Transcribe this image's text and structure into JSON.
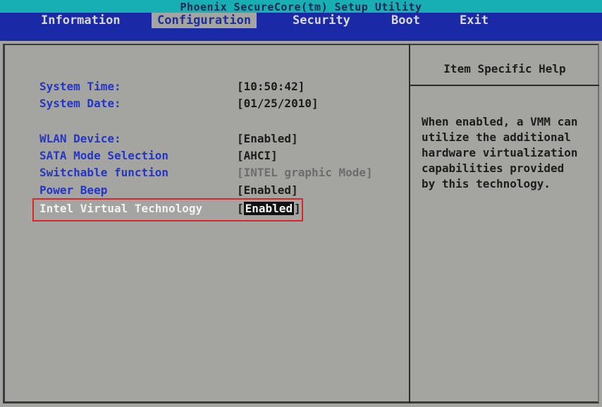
{
  "title": "Phoenix SecureCore(tm) Setup Utility",
  "menu": [
    "Information",
    "Configuration",
    "Security",
    "Boot",
    "Exit"
  ],
  "active_menu": "Configuration",
  "settings": [
    {
      "label": "System Time:",
      "value": "[10:50:42]"
    },
    {
      "label": "System Date:",
      "value": "[01/25/2010]"
    },
    {
      "label": "WLAN Device:",
      "value": "[Enabled]"
    },
    {
      "label": "SATA Mode Selection",
      "value": "[AHCI]"
    },
    {
      "label": "Switchable function",
      "value": "[INTEL graphic Mode]"
    },
    {
      "label": "Power Beep",
      "value": "[Enabled]"
    },
    {
      "label": "Intel Virtual Technology",
      "value": "Enabled",
      "value_open": "[",
      "value_close": "]"
    }
  ],
  "help": {
    "title": "Item Specific Help",
    "text": "When enabled, a VMM can\nutilize the additional\nhardware virtualization\ncapabilities provided\nby this technology."
  },
  "colors": {
    "title_bar": "#17aeb4",
    "menu_bar": "#1a2aa6",
    "background": "#a4a4a0",
    "label": "#2435c8",
    "highlight_box": "#e0222a"
  }
}
